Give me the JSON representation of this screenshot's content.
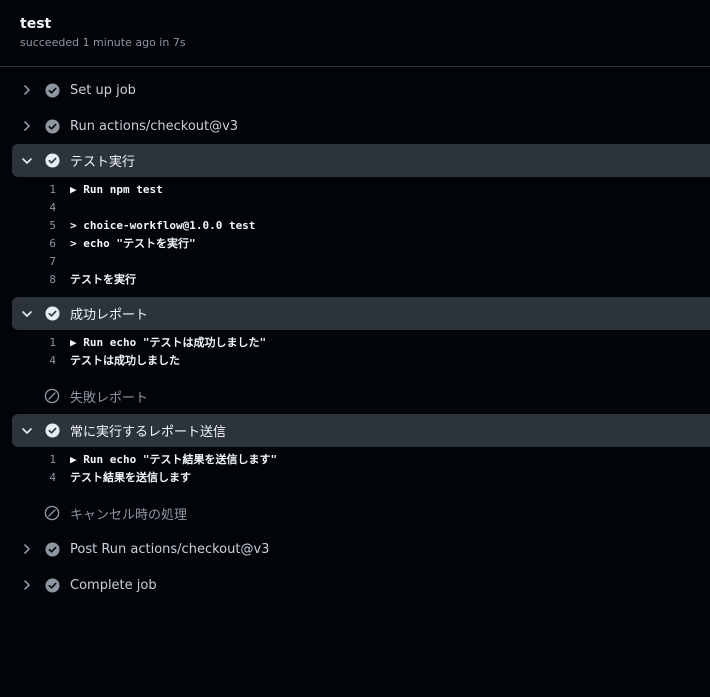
{
  "job": {
    "title": "test",
    "status": "succeeded 1 minute ago in 7s"
  },
  "colors": {
    "background": "#010409",
    "expanded_row": "#2d333b",
    "success_icon": "#8d96a0",
    "text_muted": "#8d96a0"
  },
  "steps": [
    {
      "label": "Set up job",
      "state": "success",
      "expanded": false,
      "chevron": "chevron-right-icon"
    },
    {
      "label": "Run actions/checkout@v3",
      "state": "success",
      "expanded": false,
      "chevron": "chevron-right-icon"
    },
    {
      "label": "テスト実行",
      "state": "success",
      "expanded": true,
      "chevron": "chevron-down-icon",
      "log": [
        {
          "num": "1",
          "text": "▶ Run npm test"
        },
        {
          "num": "4",
          "text": ""
        },
        {
          "num": "5",
          "text": "> choice-workflow@1.0.0 test"
        },
        {
          "num": "6",
          "text": "> echo \"テストを実行\""
        },
        {
          "num": "7",
          "text": ""
        },
        {
          "num": "8",
          "text": "テストを実行"
        }
      ]
    },
    {
      "label": "成功レポート",
      "state": "success",
      "expanded": true,
      "chevron": "chevron-down-icon",
      "log": [
        {
          "num": "1",
          "text": "▶ Run echo \"テストは成功しました\""
        },
        {
          "num": "4",
          "text": "テストは成功しました"
        }
      ]
    },
    {
      "label": "失敗レポート",
      "state": "skipped",
      "expanded": false,
      "chevron": ""
    },
    {
      "label": "常に実行するレポート送信",
      "state": "success",
      "expanded": true,
      "chevron": "chevron-down-icon",
      "log": [
        {
          "num": "1",
          "text": "▶ Run echo \"テスト結果を送信します\""
        },
        {
          "num": "4",
          "text": "テスト結果を送信します"
        }
      ]
    },
    {
      "label": "キャンセル時の処理",
      "state": "skipped",
      "expanded": false,
      "chevron": ""
    },
    {
      "label": "Post Run actions/checkout@v3",
      "state": "success",
      "expanded": false,
      "chevron": "chevron-right-icon"
    },
    {
      "label": "Complete job",
      "state": "success",
      "expanded": false,
      "chevron": "chevron-right-icon"
    }
  ]
}
